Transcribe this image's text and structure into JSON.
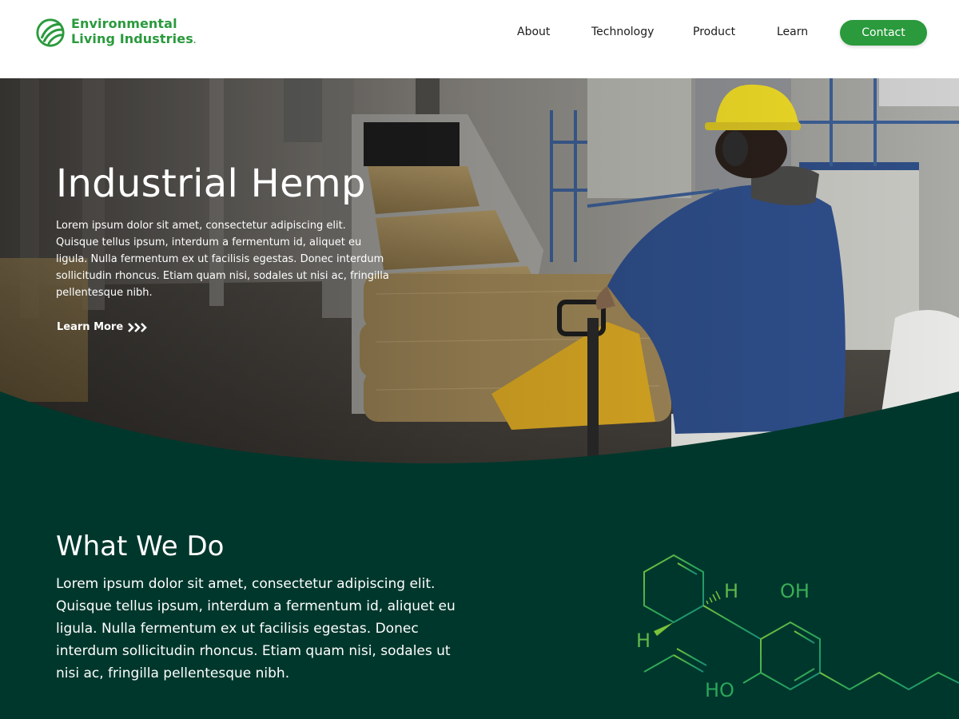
{
  "brand": {
    "name_line1": "Environmental",
    "name_line2": "Living Industries",
    "trademark": ".",
    "logo_icon": "leaf-swirl-logo",
    "color": "#2a9a3c"
  },
  "nav": {
    "items": [
      {
        "label": "About"
      },
      {
        "label": "Technology"
      },
      {
        "label": "Product"
      },
      {
        "label": "Learn"
      }
    ],
    "contact_label": "Contact"
  },
  "hero": {
    "title": "Industrial Hemp",
    "body": "Lorem ipsum dolor sit amet, consectetur adipiscing elit. Quisque tellus ipsum, interdum a fermentum id, aliquet eu ligula. Nulla fermentum ex ut facilisis egestas. Donec interdum sollicitudin rhoncus. Etiam quam nisi, sodales ut nisi ac, fringilla pellentesque nibh.",
    "cta_label": "Learn More",
    "cta_icon": "triple-chevron-right-icon",
    "image_subject": "warehouse-worker-with-hemp-bales"
  },
  "what_we_do": {
    "title": "What We Do",
    "body": "Lorem ipsum dolor sit amet, consectetur adipiscing elit. Quisque tellus ipsum, interdum a fermentum id, aliquet eu ligula. Nulla fermentum ex ut facilisis egestas. Donec interdum sollicitudin rhoncus. Etiam quam nisi, sodales ut nisi ac, fringilla pellentesque nibh.",
    "background_color": "#00372c"
  },
  "molecule": {
    "labels": {
      "h_upper": "H",
      "h_lower": "H",
      "oh_top": "OH",
      "oh_bottom": "HO"
    },
    "color_start": "#7cc33a",
    "color_end": "#1a8a7a"
  }
}
